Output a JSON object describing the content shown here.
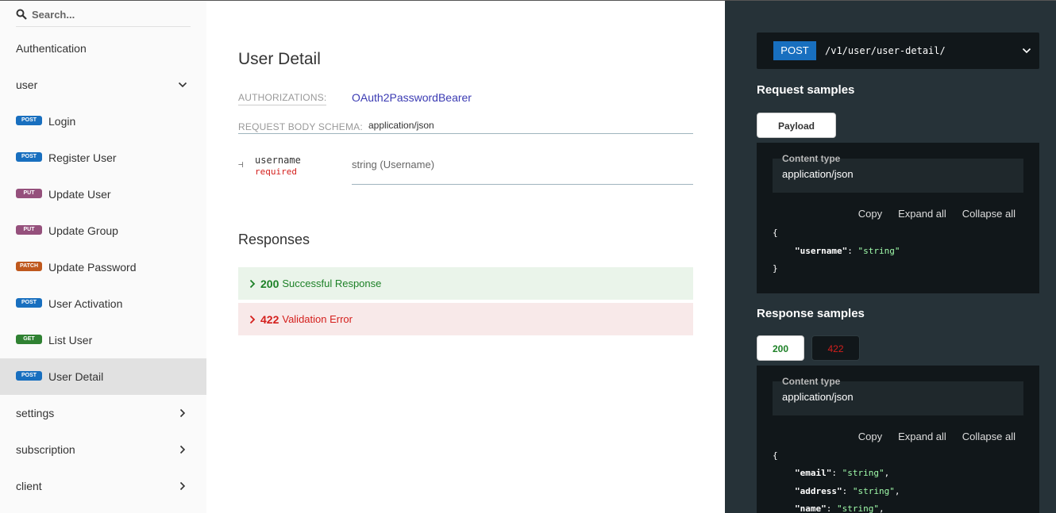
{
  "sidebar": {
    "search_placeholder": "Search...",
    "items": [
      {
        "label": "Authentication"
      },
      {
        "label": "user"
      },
      {
        "method": "POST",
        "label": "Login"
      },
      {
        "method": "POST",
        "label": "Register User"
      },
      {
        "method": "PUT",
        "label": "Update User"
      },
      {
        "method": "PUT",
        "label": "Update Group"
      },
      {
        "method": "PATCH",
        "label": "Update Password"
      },
      {
        "method": "POST",
        "label": "User Activation"
      },
      {
        "method": "GET",
        "label": "List User"
      },
      {
        "method": "POST",
        "label": "User Detail"
      },
      {
        "label": "settings"
      },
      {
        "label": "subscription"
      },
      {
        "label": "client"
      }
    ]
  },
  "operation": {
    "title": "User Detail",
    "auth_label": "AUTHORIZATIONS:",
    "auth_value": "OAuth2PasswordBearer",
    "schema_label": "REQUEST BODY SCHEMA:",
    "schema_value": "application/json",
    "param": {
      "connector": "⊣",
      "name": "username",
      "required": "required",
      "type": "string (Username)"
    },
    "responses_title": "Responses",
    "responses": [
      {
        "code": "200",
        "label": "Successful Response"
      },
      {
        "code": "422",
        "label": "Validation Error"
      }
    ]
  },
  "right": {
    "method": "POST",
    "path": "/v1/user/user-detail/",
    "request_title": "Request samples",
    "request_tab": "Payload",
    "response_title": "Response samples",
    "response_tabs": [
      "200",
      "422"
    ],
    "content_type_label": "Content type",
    "content_type_value": "application/json",
    "controls": [
      "Copy",
      "Expand all",
      "Collapse all"
    ],
    "request_code": {
      "open": "{",
      "key": "\"username\"",
      "value": "\"string\"",
      "close": "}"
    },
    "response_code": {
      "open": "{",
      "lines": [
        {
          "key": "\"email\"",
          "value": "\"string\"",
          "tail": ","
        },
        {
          "key": "\"address\"",
          "value": "\"string\"",
          "tail": ","
        },
        {
          "key": "\"name\"",
          "value": "\"string\"",
          "tail": ","
        }
      ]
    }
  },
  "colors": {
    "post": "#186fbf",
    "put": "#95507c",
    "patch": "#bf581d",
    "get": "#2f8132",
    "success": "#1d8127",
    "error": "#d41f1c",
    "dark_panel": "#263238"
  }
}
